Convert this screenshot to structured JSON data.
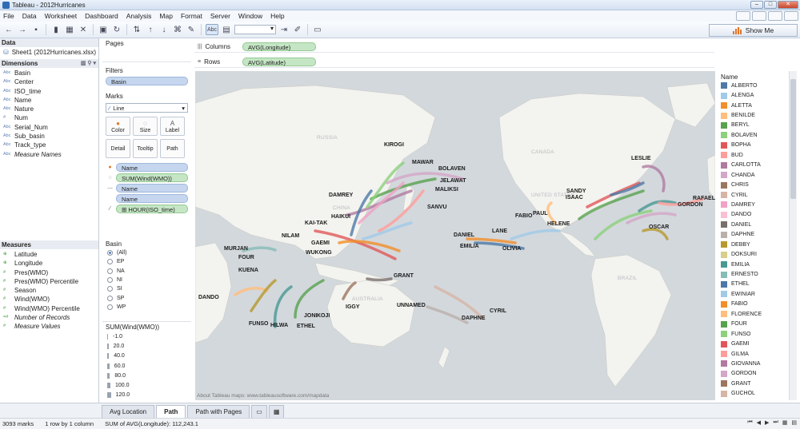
{
  "window": {
    "title": "Tableau - 2012Hurricanes"
  },
  "menu": [
    "File",
    "Data",
    "Worksheet",
    "Dashboard",
    "Analysis",
    "Map",
    "Format",
    "Server",
    "Window",
    "Help"
  ],
  "toolbar": {
    "label_button": "Abc",
    "show_me": "Show Me"
  },
  "data_pane": {
    "header": "Data",
    "source": "Sheet1 (2012Hurricanes.xlsx)",
    "dimensions_header": "Dimensions",
    "dimensions": [
      {
        "type": "Abc",
        "name": "Basin"
      },
      {
        "type": "Abc",
        "name": "Center"
      },
      {
        "type": "Abc",
        "name": "ISO_time"
      },
      {
        "type": "Abc",
        "name": "Name"
      },
      {
        "type": "Abc",
        "name": "Nature"
      },
      {
        "type": "#",
        "name": "Num"
      },
      {
        "type": "Abc",
        "name": "Serial_Num"
      },
      {
        "type": "Abc",
        "name": "Sub_basin"
      },
      {
        "type": "Abc",
        "name": "Track_type"
      },
      {
        "type": "Abc",
        "name": "Measure Names"
      }
    ],
    "measures_header": "Measures",
    "measures": [
      {
        "type": "⊕",
        "name": "Latitude"
      },
      {
        "type": "⊕",
        "name": "Longitude"
      },
      {
        "type": "#",
        "name": "Pres(WMO)"
      },
      {
        "type": "#",
        "name": "Pres(WMO) Percentile"
      },
      {
        "type": "#",
        "name": "Season"
      },
      {
        "type": "#",
        "name": "Wind(WMO)"
      },
      {
        "type": "#",
        "name": "Wind(WMO) Percentile"
      },
      {
        "type": "=#",
        "name": "Number of Records"
      },
      {
        "type": "#",
        "name": "Measure Values"
      }
    ]
  },
  "cards": {
    "pages": "Pages",
    "filters": "Filters",
    "filter_pill": "Basin",
    "marks": "Marks",
    "mark_type": "Line",
    "mark_buttons": [
      "Color",
      "Size",
      "Label",
      "Detail",
      "Tooltip",
      "Path"
    ],
    "mark_pills": [
      "Name",
      "SUM(Wind(WMO))",
      "Name",
      "Name",
      "HOUR(ISO_time)"
    ],
    "basin_title": "Basin",
    "basin_options": [
      "(All)",
      "EP",
      "NA",
      "NI",
      "SI",
      "SP",
      "WP"
    ],
    "size_title": "SUM(Wind(WMO))",
    "size_values": [
      "-1.0",
      "20.0",
      "40.0",
      "60.0",
      "80.0",
      "100.0",
      "120.0"
    ]
  },
  "shelves": {
    "columns_label": "Columns",
    "columns_pill": "AVG(Longitude)",
    "rows_label": "Rows",
    "rows_pill": "AVG(Latitude)"
  },
  "map": {
    "attribution": "About Tableau maps: www.tableausoftware.com/mapdata",
    "geo_labels": [
      "RUSSIA",
      "CHINA",
      "CANADA",
      "UNITED STATES",
      "BRAZIL",
      "AUSTRALIA"
    ],
    "storm_labels": [
      "KIROGI",
      "MAWAR",
      "BOLAVEN",
      "JELAWAT",
      "MALIKSI",
      "DAMREY",
      "SANVU",
      "HAIKUI",
      "KAI-TAK",
      "NILAM",
      "GAEMI",
      "WUKONG",
      "MURJAN",
      "FOUR",
      "KUENA",
      "DANDO",
      "FUNSO",
      "HILWA",
      "ETHEL",
      "JONI",
      "KOJI",
      "IGGY",
      "GRANT",
      "UNNAMED",
      "DAPHNE",
      "CYRIL",
      "DANIEL",
      "EMILIA",
      "LANE",
      "OLIVIA",
      "FABIO",
      "PAUL",
      "HELENE",
      "SANDY",
      "ISAAC",
      "LESLIE",
      "RAFAEL",
      "GORDON",
      "OSCAR"
    ]
  },
  "legend": {
    "title": "Name",
    "items": [
      {
        "name": "ALBERTO",
        "color": "#4e79a7"
      },
      {
        "name": "ALENGA",
        "color": "#a0cbe8"
      },
      {
        "name": "ALETTA",
        "color": "#f28e2b"
      },
      {
        "name": "BENILDE",
        "color": "#ffbe7d"
      },
      {
        "name": "BERYL",
        "color": "#59a14f"
      },
      {
        "name": "BOLAVEN",
        "color": "#8cd17d"
      },
      {
        "name": "BOPHA",
        "color": "#e15759"
      },
      {
        "name": "BUD",
        "color": "#ff9d9a"
      },
      {
        "name": "CARLOTTA",
        "color": "#b07aa1"
      },
      {
        "name": "CHANDA",
        "color": "#d4a6c8"
      },
      {
        "name": "CHRIS",
        "color": "#9d7660"
      },
      {
        "name": "CYRIL",
        "color": "#d7b5a6"
      },
      {
        "name": "DAMREY",
        "color": "#f1a2c4"
      },
      {
        "name": "DANDO",
        "color": "#fabfd2"
      },
      {
        "name": "DANIEL",
        "color": "#79706e"
      },
      {
        "name": "DAPHNE",
        "color": "#bab0ac"
      },
      {
        "name": "DEBBY",
        "color": "#b6992d"
      },
      {
        "name": "DOKSURI",
        "color": "#d7cf8a"
      },
      {
        "name": "EMILIA",
        "color": "#499894"
      },
      {
        "name": "ERNESTO",
        "color": "#86bcb6"
      },
      {
        "name": "ETHEL",
        "color": "#4e79a7"
      },
      {
        "name": "EWINIAR",
        "color": "#a0cbe8"
      },
      {
        "name": "FABIO",
        "color": "#f28e2b"
      },
      {
        "name": "FLORENCE",
        "color": "#ffbe7d"
      },
      {
        "name": "FOUR",
        "color": "#59a14f"
      },
      {
        "name": "FUNSO",
        "color": "#8cd17d"
      },
      {
        "name": "GAEMI",
        "color": "#e15759"
      },
      {
        "name": "GILMA",
        "color": "#ff9d9a"
      },
      {
        "name": "GIOVANNA",
        "color": "#b07aa1"
      },
      {
        "name": "GORDON",
        "color": "#d4a6c8"
      },
      {
        "name": "GRANT",
        "color": "#9d7660"
      },
      {
        "name": "GUCHOL",
        "color": "#d7b5a6"
      }
    ]
  },
  "tabs": [
    "Avg Location",
    "Path",
    "Path with Pages"
  ],
  "status": {
    "marks": "3093 marks",
    "grid": "1 row by 1 column",
    "sum": "SUM of AVG(Longitude): 112,243.1"
  }
}
